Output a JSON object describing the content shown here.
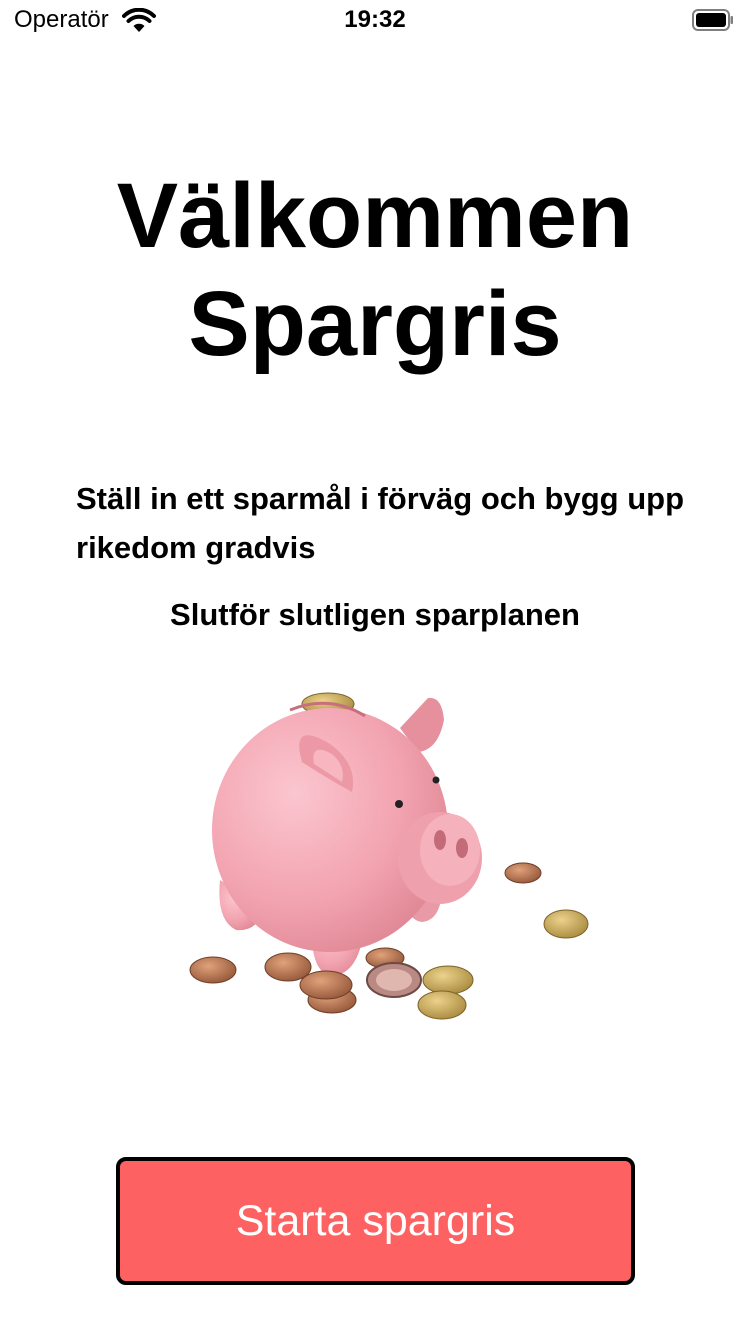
{
  "status_bar": {
    "carrier": "Operatör",
    "time": "19:32",
    "icons": [
      "wifi-icon",
      "battery-icon"
    ]
  },
  "welcome": {
    "title_line1": "Välkommen",
    "title_line2": "Spargris",
    "description": "Ställ in ett sparmål i förväg och bygg upp rikedom gradvis",
    "subtitle": "Slutför slutligen sparplanen"
  },
  "illustration": {
    "name": "piggy-bank-with-coins"
  },
  "actions": {
    "start_label": "Starta spargris"
  },
  "colors": {
    "accent": "#fe6162",
    "pig": "#f2a5b1",
    "coin": "#b77a52"
  }
}
